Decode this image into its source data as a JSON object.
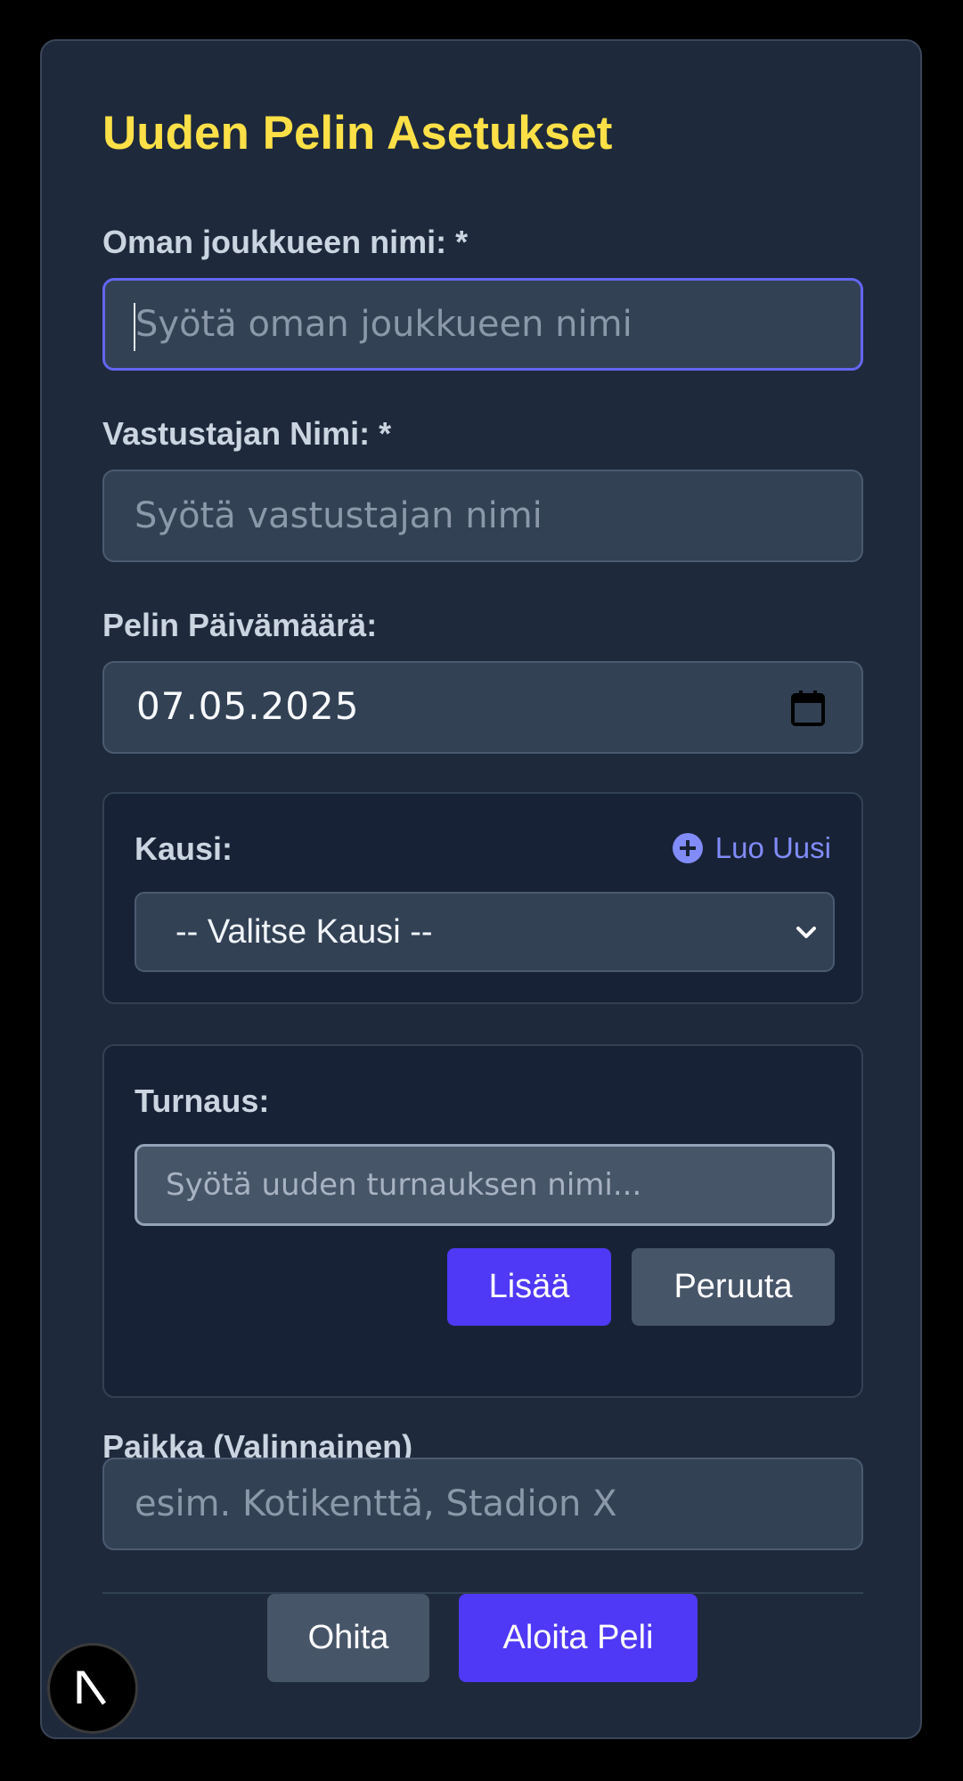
{
  "modal": {
    "title": "Uuden Pelin Asetukset"
  },
  "form": {
    "team_name": {
      "label": "Oman joukkueen nimi: *",
      "placeholder": "Syötä oman joukkueen nimi",
      "value": ""
    },
    "opponent_name": {
      "label": "Vastustajan Nimi: *",
      "placeholder": "Syötä vastustajan nimi",
      "value": ""
    },
    "game_date": {
      "label": "Pelin Päivämäärä:",
      "value": "07.05.2025",
      "icon": "calendar-icon"
    },
    "season": {
      "label": "Kausi:",
      "create_link": "Luo Uusi",
      "create_icon": "plus-circle-icon",
      "selected": "-- Valitse Kausi --",
      "options": [
        "-- Valitse Kausi --"
      ],
      "icon": "chevron-down-icon"
    },
    "tournament": {
      "label": "Turnaus:",
      "placeholder": "Syötä uuden turnauksen nimi...",
      "value": "",
      "add_button": "Lisää",
      "cancel_button": "Peruuta"
    },
    "location": {
      "label": "Paikka (Valinnainen)",
      "placeholder": "esim. Kotikenttä, Stadion X",
      "value": ""
    }
  },
  "footer": {
    "skip_button": "Ohita",
    "start_button": "Aloita Peli"
  },
  "badge": {
    "icon": "nextjs-logo-icon"
  },
  "colors": {
    "page_background": "#000000",
    "modal_background": "#1e293b",
    "title": "#fde047",
    "accent": "#4f39f6",
    "link": "#818cf8",
    "focus_border": "#6366f1"
  }
}
